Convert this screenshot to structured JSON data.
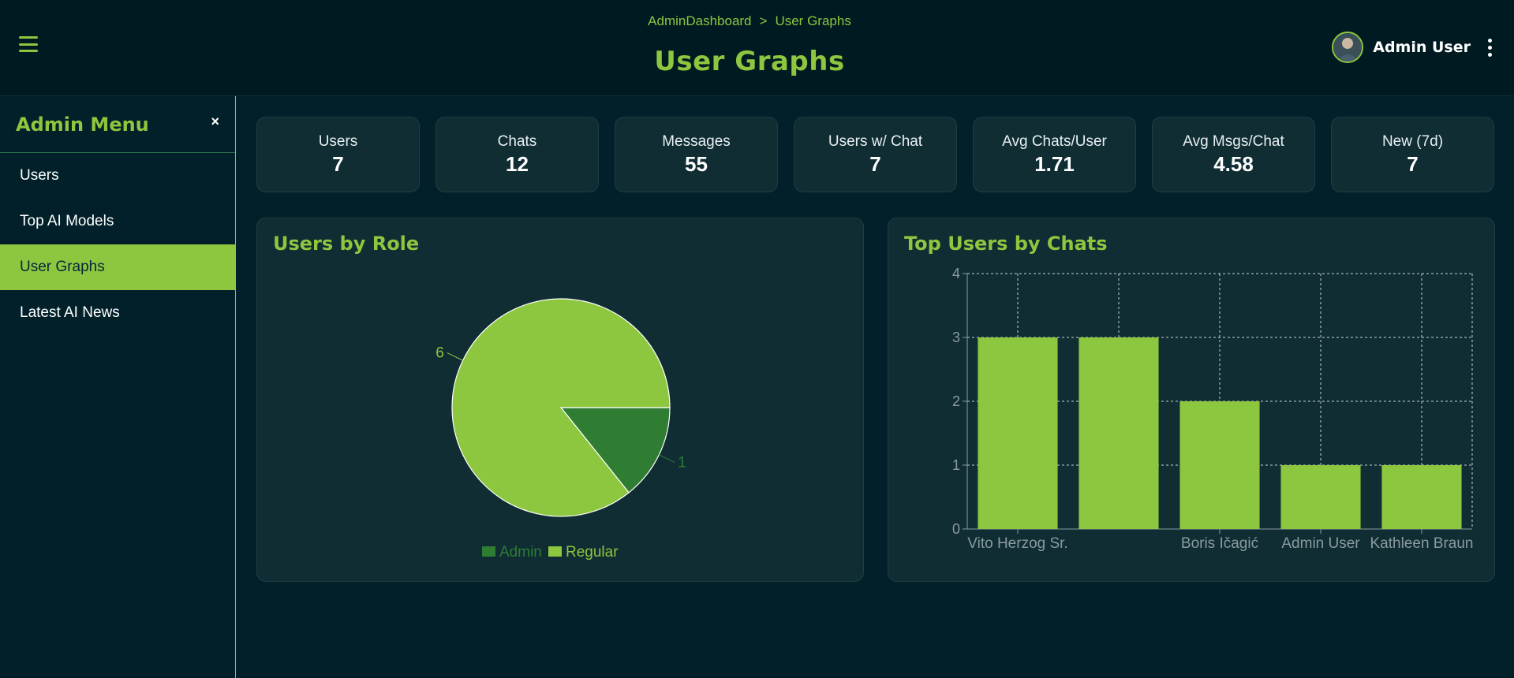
{
  "header": {
    "breadcrumb": [
      "AdminDashboard",
      "User Graphs"
    ],
    "breadcrumb_sep": ">",
    "title": "User Graphs",
    "user_name": "Admin User"
  },
  "sidebar": {
    "title": "Admin Menu",
    "close_glyph": "×",
    "items": [
      {
        "label": "Users",
        "active": false
      },
      {
        "label": "Top AI Models",
        "active": false
      },
      {
        "label": "User Graphs",
        "active": true
      },
      {
        "label": "Latest AI News",
        "active": false
      }
    ]
  },
  "stats": [
    {
      "label": "Users",
      "value": "7"
    },
    {
      "label": "Chats",
      "value": "12"
    },
    {
      "label": "Messages",
      "value": "55"
    },
    {
      "label": "Users w/ Chat",
      "value": "7"
    },
    {
      "label": "Avg Chats/User",
      "value": "1.71"
    },
    {
      "label": "Avg Msgs/Chat",
      "value": "4.58"
    },
    {
      "label": "New (7d)",
      "value": "7"
    }
  ],
  "colors": {
    "accent": "#8dc63f",
    "admin": "#2e7d32",
    "regular": "#8dc63f",
    "background": "#01202a",
    "panel": "#0f2d33"
  },
  "icons": {
    "menu": "hamburger-icon",
    "avatar": "user-avatar",
    "more": "more-vertical-icon",
    "close": "close-icon"
  },
  "chart_data": [
    {
      "type": "pie",
      "title": "Users by Role",
      "categories": [
        "Admin",
        "Regular"
      ],
      "values": [
        1,
        6
      ],
      "colors": [
        "#2e7d32",
        "#8dc63f"
      ],
      "data_labels": [
        "1",
        "6"
      ],
      "legend": "bottom"
    },
    {
      "type": "bar",
      "title": "Top Users by Chats",
      "categories": [
        "Vito Herzog Sr.",
        "",
        "Boris Ičagić",
        "Admin User",
        "Kathleen Braun"
      ],
      "values": [
        3,
        3,
        2,
        1,
        1
      ],
      "ylim": [
        0,
        4
      ],
      "yticks": [
        0,
        1,
        2,
        3,
        4
      ],
      "grid": true,
      "color": "#8dc63f"
    }
  ]
}
